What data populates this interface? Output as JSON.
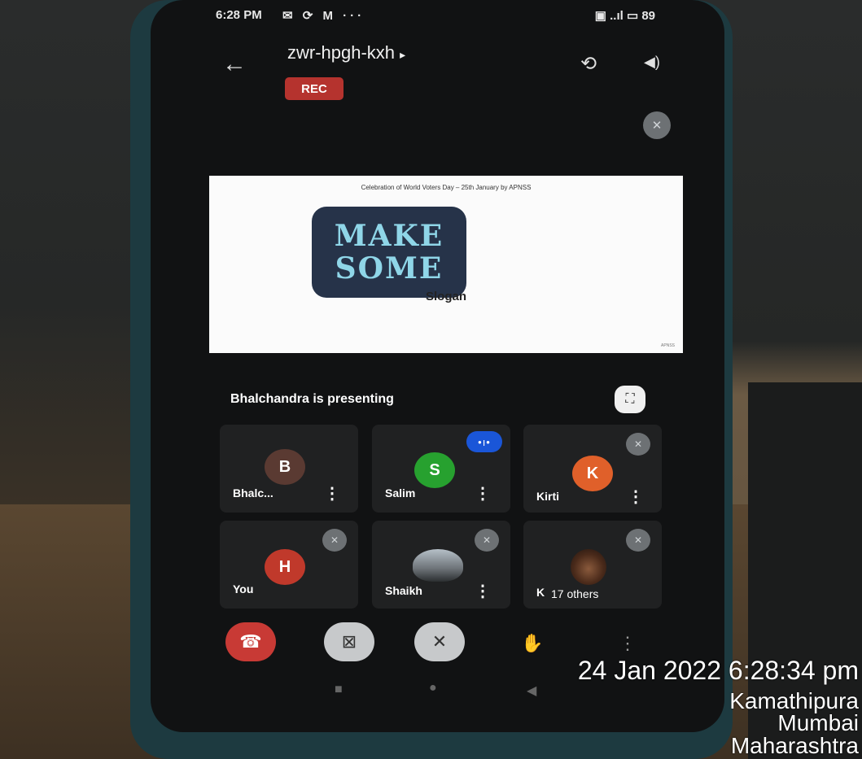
{
  "status_bar": {
    "time": "6:28 PM",
    "left_icons": "✉ ⟳ M ···",
    "right_icons": "▣ ..ıl ▭",
    "battery": "89"
  },
  "header": {
    "meeting_code": "zwr-hpgh-kxh",
    "meeting_chevron": "▸",
    "rec_badge": "REC",
    "back_icon": "←",
    "switch_camera_icon": "⟲",
    "speaker_icon": "◀)"
  },
  "slide": {
    "header": "Celebration of World Voters Day – 25th January by APNSS",
    "art_line1": "MAKE",
    "art_line2": "SOME",
    "caption": "Slogan",
    "footer": "APNSS"
  },
  "presenting": {
    "text": "Bhalchandra is presenting",
    "fullscreen_icon": "⛶"
  },
  "participants": [
    {
      "initial": "B",
      "name": "Bhalc...",
      "color": "#5a3a32",
      "state": "none"
    },
    {
      "initial": "S",
      "name": "Salim",
      "color": "#27a12f",
      "state": "speaking"
    },
    {
      "initial": "K",
      "name": "Kirti",
      "color": "#e0602a",
      "state": "muted"
    },
    {
      "initial": "H",
      "name": "You",
      "color": "#c0392b",
      "state": "muted"
    },
    {
      "initial": "",
      "name": "Shaikh",
      "color": "#888888",
      "state": "muted"
    },
    {
      "initial": "",
      "name": "K",
      "others": "17 others",
      "color": "#5a3a2a",
      "state": "muted"
    }
  ],
  "tile_icons": {
    "more": "⋮",
    "mute": "✕",
    "speaking": "•ı•"
  },
  "controls": {
    "hangup_icon": "☎",
    "camera_icon": "⊠",
    "mic_icon": "✕",
    "hand_icon": "✋",
    "more_icon": "⋮"
  },
  "nav": {
    "recents_icon": "■",
    "home_icon": "●",
    "back_icon": "◀"
  },
  "overlay": {
    "datetime": "24 Jan 2022 6:28:34 pm",
    "line1": "Kamathipura",
    "line2": "Mumbai",
    "line3": "Maharashtra"
  }
}
